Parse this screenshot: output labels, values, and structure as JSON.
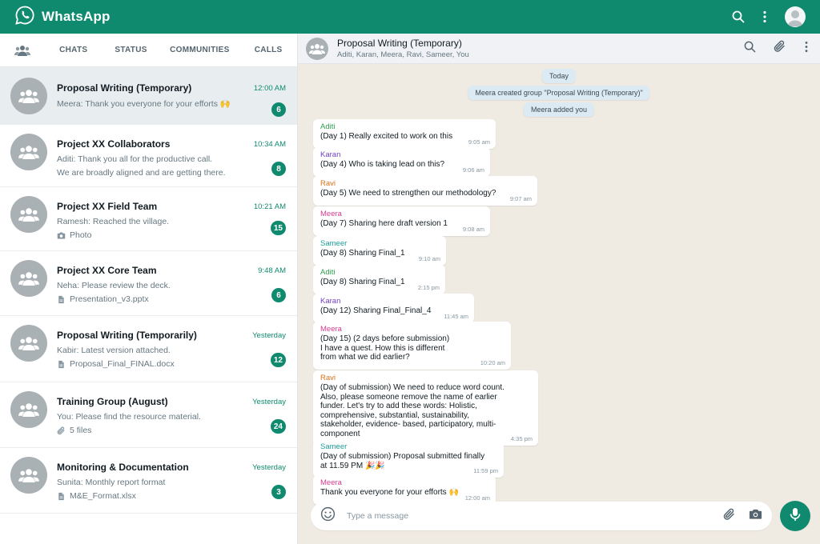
{
  "app": {
    "name": "WhatsApp"
  },
  "colors": {
    "brand": "#108a6f",
    "active_chat": "#e8eef0",
    "chat_bg": "#efeae2",
    "system_bubble": "#dbeaf3"
  },
  "tabs": [
    {
      "label": "CHATS",
      "active": true
    },
    {
      "label": "STATUS",
      "active": false
    },
    {
      "label": "COMMUNITIES",
      "active": false
    },
    {
      "label": "CALLS",
      "active": false
    }
  ],
  "chats": [
    {
      "name": "Proposal Writing (Temporary)",
      "line1": "Meera: Thank you everyone for your efforts 🙌",
      "line2": "",
      "line2_icon": "",
      "time": "12:00 AM",
      "unread": "6",
      "active": true
    },
    {
      "name": "Project XX Collaborators",
      "line1": "Aditi: Thank you all for the productive call.",
      "line2": "We are broadly aligned and are getting there.",
      "line2_icon": "",
      "time": "10:34 AM",
      "unread": "8",
      "active": false
    },
    {
      "name": "Project XX Field Team",
      "line1": "Ramesh: Reached the village.",
      "line2": "Photo",
      "line2_icon": "camera-icon",
      "time": "10:21 AM",
      "unread": "15",
      "active": false
    },
    {
      "name": "Project XX Core Team",
      "line1": "Neha: Please review the deck.",
      "line2": "Presentation_v3.pptx",
      "line2_icon": "document-icon",
      "time": "9:48 AM",
      "unread": "6",
      "active": false
    },
    {
      "name": "Proposal Writing (Temporarily)",
      "line1": "Kabir: Latest version attached.",
      "line2": "Proposal_Final_FINAL.docx",
      "line2_icon": "document-icon",
      "time": "Yesterday",
      "unread": "12",
      "active": false
    },
    {
      "name": "Training Group (August)",
      "line1": "You: Please find the resource material.",
      "line2": "5 files",
      "line2_icon": "attachment-icon",
      "time": "Yesterday",
      "unread": "24",
      "active": false
    },
    {
      "name": "Monitoring & Documentation",
      "line1": "Sunita: Monthly report format",
      "line2": "M&E_Format.xlsx",
      "line2_icon": "document-icon",
      "time": "Yesterday",
      "unread": "3",
      "active": false
    }
  ],
  "conversation": {
    "title": "Proposal Writing (Temporary)",
    "participants": "Aditi, Karan, Meera, Ravi, Sameer, You",
    "system_messages": [
      "Today",
      "Meera created group \"Proposal Writing (Temporary)\"",
      "Meera added you"
    ],
    "messages": [
      {
        "sender": "Aditi",
        "color": "#2e9e4f",
        "lines": [
          "(Day 1) Really excited to work on this"
        ],
        "time": "9:05 am"
      },
      {
        "sender": "Karan",
        "color": "#6f3fc4",
        "lines": [
          "(Day 4) Who is taking lead on this?"
        ],
        "time": "9:06 am"
      },
      {
        "sender": "Ravi",
        "color": "#d9731a",
        "lines": [
          "(Day 5) We need to strengthen our methodology?"
        ],
        "time": "9:07 am"
      },
      {
        "sender": "Meera",
        "color": "#d63b8f",
        "lines": [
          "(Day 7) Sharing here draft version 1"
        ],
        "time": "9:08 am"
      },
      {
        "sender": "Sameer",
        "color": "#1f9c9a",
        "lines": [
          "(Day 8) Sharing Final_1"
        ],
        "time": "9:10 am"
      },
      {
        "sender": "Aditi",
        "color": "#2e9e4f",
        "lines": [
          "(Day 8) Sharing Final_1"
        ],
        "time": "2:15 pm"
      },
      {
        "sender": "Karan",
        "color": "#6f3fc4",
        "lines": [
          "(Day 12) Sharing Final_Final_4"
        ],
        "time": "11:45 am"
      },
      {
        "sender": "Meera",
        "color": "#d63b8f",
        "lines": [
          "(Day 15) (2 days before submission)",
          "I have a quest. How this is different",
          "from what we did earlier?"
        ],
        "time": "10:20 am"
      },
      {
        "sender": "Ravi",
        "color": "#d9731a",
        "lines": [
          "(Day of submission) We need to reduce word count.",
          "Also, please someone remove the name of earlier",
          "funder. Let's try to add these words: Holistic,",
          "comprehensive, substantial, sustainability,",
          "stakeholder, evidence- based, participatory, multi-",
          "component"
        ],
        "time": "4:35 pm"
      },
      {
        "sender": "Sameer",
        "color": "#1f9c9a",
        "lines": [
          "(Day of submission) Proposal submitted finally",
          "at 11.59 PM 🎉🎉"
        ],
        "time": "11:59 pm"
      },
      {
        "sender": "Meera",
        "color": "#d63b8f",
        "lines": [
          "Thank you everyone for your efforts 🙌"
        ],
        "time": "12:00 am"
      }
    ]
  },
  "composer": {
    "placeholder": "Type a message"
  }
}
